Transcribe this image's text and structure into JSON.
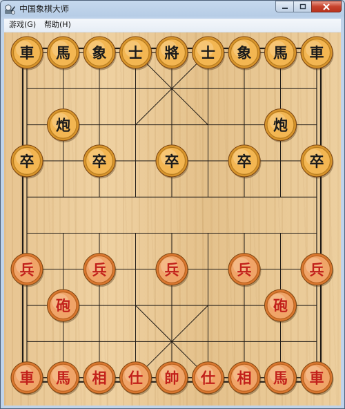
{
  "window": {
    "title": "中国象棋大师"
  },
  "menu": [
    {
      "label": "游戏(G)"
    },
    {
      "label": "帮助(H)"
    }
  ],
  "colors": {
    "black_text": "#1a1a1a",
    "red_text": "#c2201a",
    "black_face": "#f3b652",
    "red_face": "#f0a468",
    "board_line": "#1e1a16"
  },
  "pieces": [
    {
      "side": "black",
      "char": "車",
      "file": 0,
      "rank": 0
    },
    {
      "side": "black",
      "char": "馬",
      "file": 1,
      "rank": 0
    },
    {
      "side": "black",
      "char": "象",
      "file": 2,
      "rank": 0
    },
    {
      "side": "black",
      "char": "士",
      "file": 3,
      "rank": 0
    },
    {
      "side": "black",
      "char": "將",
      "file": 4,
      "rank": 0
    },
    {
      "side": "black",
      "char": "士",
      "file": 5,
      "rank": 0
    },
    {
      "side": "black",
      "char": "象",
      "file": 6,
      "rank": 0
    },
    {
      "side": "black",
      "char": "馬",
      "file": 7,
      "rank": 0
    },
    {
      "side": "black",
      "char": "車",
      "file": 8,
      "rank": 0
    },
    {
      "side": "black",
      "char": "炮",
      "file": 1,
      "rank": 2
    },
    {
      "side": "black",
      "char": "炮",
      "file": 7,
      "rank": 2
    },
    {
      "side": "black",
      "char": "卒",
      "file": 0,
      "rank": 3
    },
    {
      "side": "black",
      "char": "卒",
      "file": 2,
      "rank": 3
    },
    {
      "side": "black",
      "char": "卒",
      "file": 4,
      "rank": 3
    },
    {
      "side": "black",
      "char": "卒",
      "file": 6,
      "rank": 3
    },
    {
      "side": "black",
      "char": "卒",
      "file": 8,
      "rank": 3
    },
    {
      "side": "red",
      "char": "兵",
      "file": 0,
      "rank": 6
    },
    {
      "side": "red",
      "char": "兵",
      "file": 2,
      "rank": 6
    },
    {
      "side": "red",
      "char": "兵",
      "file": 4,
      "rank": 6
    },
    {
      "side": "red",
      "char": "兵",
      "file": 6,
      "rank": 6
    },
    {
      "side": "red",
      "char": "兵",
      "file": 8,
      "rank": 6
    },
    {
      "side": "red",
      "char": "砲",
      "file": 1,
      "rank": 7
    },
    {
      "side": "red",
      "char": "砲",
      "file": 7,
      "rank": 7
    },
    {
      "side": "red",
      "char": "車",
      "file": 0,
      "rank": 9
    },
    {
      "side": "red",
      "char": "馬",
      "file": 1,
      "rank": 9
    },
    {
      "side": "red",
      "char": "相",
      "file": 2,
      "rank": 9
    },
    {
      "side": "red",
      "char": "仕",
      "file": 3,
      "rank": 9
    },
    {
      "side": "red",
      "char": "帥",
      "file": 4,
      "rank": 9
    },
    {
      "side": "red",
      "char": "仕",
      "file": 5,
      "rank": 9
    },
    {
      "side": "red",
      "char": "相",
      "file": 6,
      "rank": 9
    },
    {
      "side": "red",
      "char": "馬",
      "file": 7,
      "rank": 9
    },
    {
      "side": "red",
      "char": "車",
      "file": 8,
      "rank": 9
    }
  ]
}
